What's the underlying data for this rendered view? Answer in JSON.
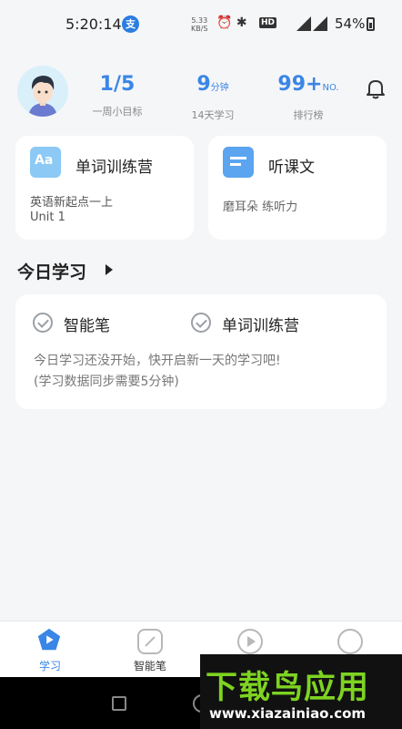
{
  "status_bar": {
    "time": "5:20:14",
    "speed_value": "5.33",
    "speed_unit": "KB/S",
    "hd_badge": "HD",
    "battery": "54%"
  },
  "profile": {
    "stats": [
      {
        "value": "1/5",
        "unit": "",
        "label": "一周小目标"
      },
      {
        "value": "9",
        "unit": "分钟",
        "label": "14天学习"
      },
      {
        "value": "99+",
        "unit": "NO.",
        "label": "排行榜"
      }
    ]
  },
  "cards": {
    "vocab": {
      "icon_text": "Aa",
      "title": "单词训练营",
      "line1": "英语新起点一上",
      "line2": "Unit 1"
    },
    "listen": {
      "title": "听课文",
      "subtitle": "磨耳朵 练听力"
    }
  },
  "today": {
    "title": "今日学习",
    "items": [
      "智能笔",
      "单词训练营"
    ],
    "message_line1": "今日学习还没开始，快开启新一天的学习吧!",
    "message_line2": "(学习数据同步需要5分钟)"
  },
  "bottom_nav": {
    "items": [
      {
        "label": "学习",
        "active": true
      },
      {
        "label": "智能笔",
        "active": false
      },
      {
        "label": "",
        "active": false
      },
      {
        "label": "",
        "active": false
      }
    ]
  },
  "watermark": {
    "brand": "下载鸟应用",
    "url": "www.xiazainiao.com"
  },
  "colors": {
    "accent": "#3a86e6",
    "background": "#f5f6f8",
    "watermark_green": "#7ed321"
  }
}
